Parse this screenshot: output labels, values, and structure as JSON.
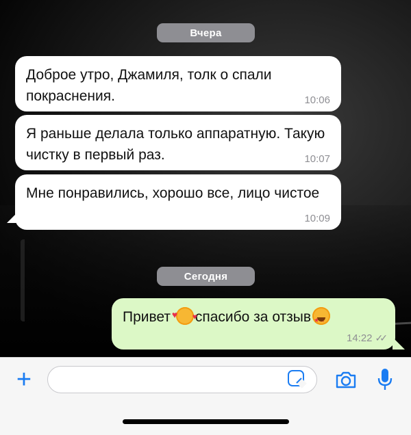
{
  "dates": {
    "yesterday": "Вчера",
    "today": "Сегодня"
  },
  "messages": [
    {
      "text": "Доброе утро, Джамиля, толк о спали покраснения.",
      "time": "10:06"
    },
    {
      "text": "Я раньше делала только аппаратную. Такую чистку в первый раз.",
      "time": "10:07"
    },
    {
      "text": "Мне понравились, хорошо все, лицо чистое",
      "time": "10:09"
    }
  ],
  "reply": {
    "part1": "Привет ",
    "part2": "спасибо за отзыв",
    "time": "14:22",
    "status_icon": "double-check-icon"
  },
  "composer": {
    "placeholder": ""
  },
  "colors": {
    "accent": "#1a7cf2",
    "outgoing": "#dcf8c6",
    "incoming": "#ffffff",
    "pill": "#8e8e93"
  }
}
